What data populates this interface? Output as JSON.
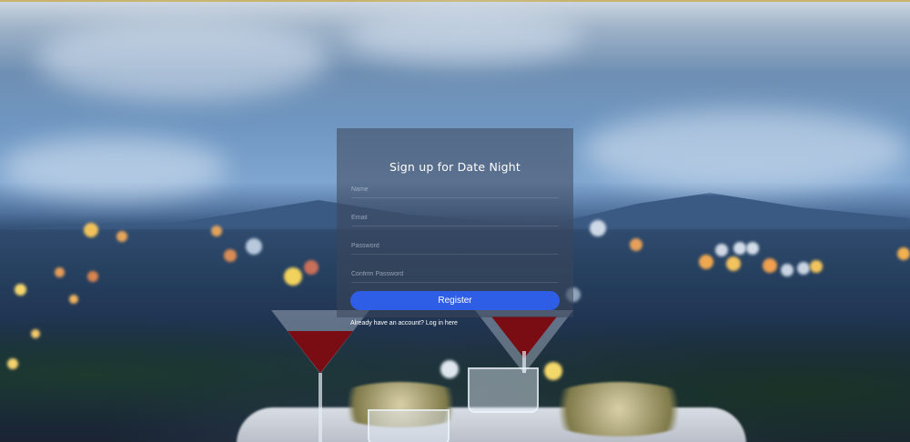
{
  "form": {
    "title": "Sign up for Date Night",
    "name_placeholder": "Name",
    "email_placeholder": "Email",
    "password_placeholder": "Password",
    "confirm_placeholder": "Confirm Password",
    "register_label": "Register",
    "login_prompt": "Already have an account?",
    "login_link": "Log in here"
  },
  "colors": {
    "button": "#2f5ee6",
    "panel": "rgba(60,70,90,0.55)"
  }
}
